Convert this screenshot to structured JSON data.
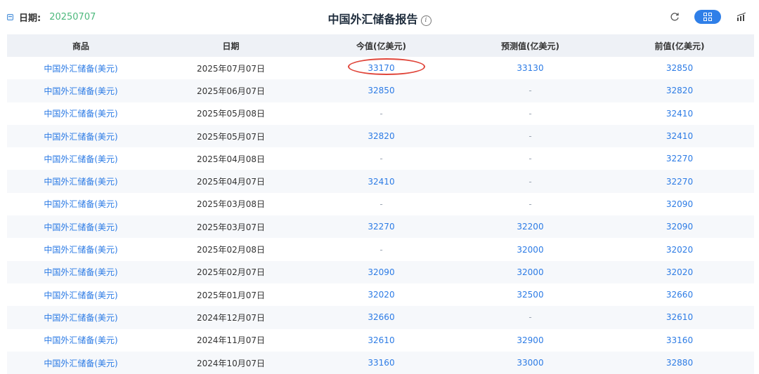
{
  "header": {
    "date_label": "日期:",
    "date_value": "20250707",
    "title": "中国外汇储备报告",
    "info_icon_text": "i",
    "icons": [
      "calendar-icon",
      "info-icon",
      "refresh-icon",
      "grid-view-icon",
      "chart-view-icon"
    ]
  },
  "table": {
    "columns": [
      "商品",
      "日期",
      "今值(亿美元)",
      "预测值(亿美元)",
      "前值(亿美元)"
    ],
    "rows": [
      [
        "中国外汇储备(美元)",
        "2025年07月07日",
        "33170",
        "33130",
        "32850"
      ],
      [
        "中国外汇储备(美元)",
        "2025年06月07日",
        "32850",
        "-",
        "32820"
      ],
      [
        "中国外汇储备(美元)",
        "2025年05月08日",
        "-",
        "-",
        "32410"
      ],
      [
        "中国外汇储备(美元)",
        "2025年05月07日",
        "32820",
        "-",
        "32410"
      ],
      [
        "中国外汇储备(美元)",
        "2025年04月08日",
        "-",
        "-",
        "32270"
      ],
      [
        "中国外汇储备(美元)",
        "2025年04月07日",
        "32410",
        "-",
        "32270"
      ],
      [
        "中国外汇储备(美元)",
        "2025年03月08日",
        "-",
        "-",
        "32090"
      ],
      [
        "中国外汇储备(美元)",
        "2025年03月07日",
        "32270",
        "32200",
        "32090"
      ],
      [
        "中国外汇储备(美元)",
        "2025年02月08日",
        "-",
        "32000",
        "32020"
      ],
      [
        "中国外汇储备(美元)",
        "2025年02月07日",
        "32090",
        "32000",
        "32020"
      ],
      [
        "中国外汇储备(美元)",
        "2025年01月07日",
        "32020",
        "32500",
        "32660"
      ],
      [
        "中国外汇储备(美元)",
        "2024年12月07日",
        "32660",
        "-",
        "32610"
      ],
      [
        "中国外汇储备(美元)",
        "2024年11月07日",
        "32610",
        "32900",
        "33160"
      ],
      [
        "中国外汇储备(美元)",
        "2024年10月07日",
        "33160",
        "33000",
        "32880"
      ]
    ]
  },
  "colors": {
    "link_blue": "#2c7be5",
    "date_green": "#4cb87c",
    "highlight_circle": "#e0453a",
    "toggle_blue": "#2f7fe8"
  }
}
